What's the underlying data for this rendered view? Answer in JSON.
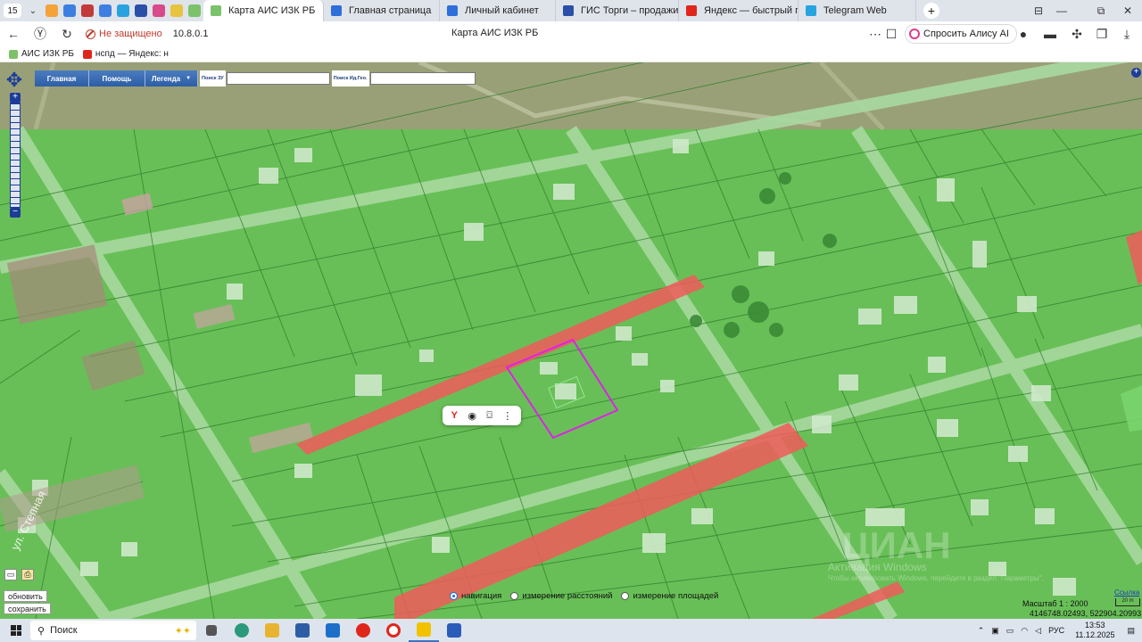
{
  "browser": {
    "tab_count": "15",
    "tabs": [
      {
        "label": "Карта АИС ИЗК РБ",
        "active": true,
        "color": "#7cc26a"
      },
      {
        "label": "Главная страница",
        "active": false,
        "color": "#2e6fd9"
      },
      {
        "label": "Личный кабинет",
        "active": false,
        "color": "#2e6fd9"
      },
      {
        "label": "ГИС Торги – продажи гос",
        "active": false,
        "color": "#2a4fa8"
      },
      {
        "label": "Яндекс — быстрый поиск",
        "active": false,
        "color": "#e0261b"
      },
      {
        "label": "Telegram Web",
        "active": false,
        "color": "#29a3e0"
      }
    ],
    "insecure_label": "Не защищено",
    "url": "10.8.0.1",
    "page_title": "Карта АИС ИЗК РБ",
    "alisa_label": "Спросить Алису AI",
    "bookmarks": [
      {
        "label": "АИС ИЗК РБ",
        "color": "#7cc26a"
      },
      {
        "label": "нспд — Яндекс: н",
        "color": "#e0261b"
      }
    ]
  },
  "map_ui": {
    "menu": [
      "Главная",
      "Помощь",
      "Легенда"
    ],
    "search_zu_label": "Поиск ЗУ",
    "search_geo_label": "Поиск Ид.Гео.",
    "refresh_label": "обновить",
    "save_label": "сохранить",
    "modes": [
      {
        "label": "навигация",
        "selected": true
      },
      {
        "label": "измерение расстояний",
        "selected": false
      },
      {
        "label": "измерение площадей",
        "selected": false
      }
    ],
    "links_label": "Ссылка",
    "scale_label": "Масштаб 1 : 2000",
    "scale_bar_label": "20 m",
    "coords": "4146748.02493, 522904.20993",
    "watermark_big": "ЦИАН",
    "watermark_line1": "Активация Windows",
    "watermark_line2": "Чтобы активировать Windows, перейдите в раздел \"Параметры\"."
  },
  "taskbar": {
    "search_label": "Поиск",
    "lang": "РУС",
    "time": "13:53",
    "date": "11.12.2025"
  },
  "colors": {
    "zone_green": "#63d35b",
    "road_red": "#f05a5a",
    "selection": "#e020e8",
    "ui_blue": "#2d5ea5"
  }
}
